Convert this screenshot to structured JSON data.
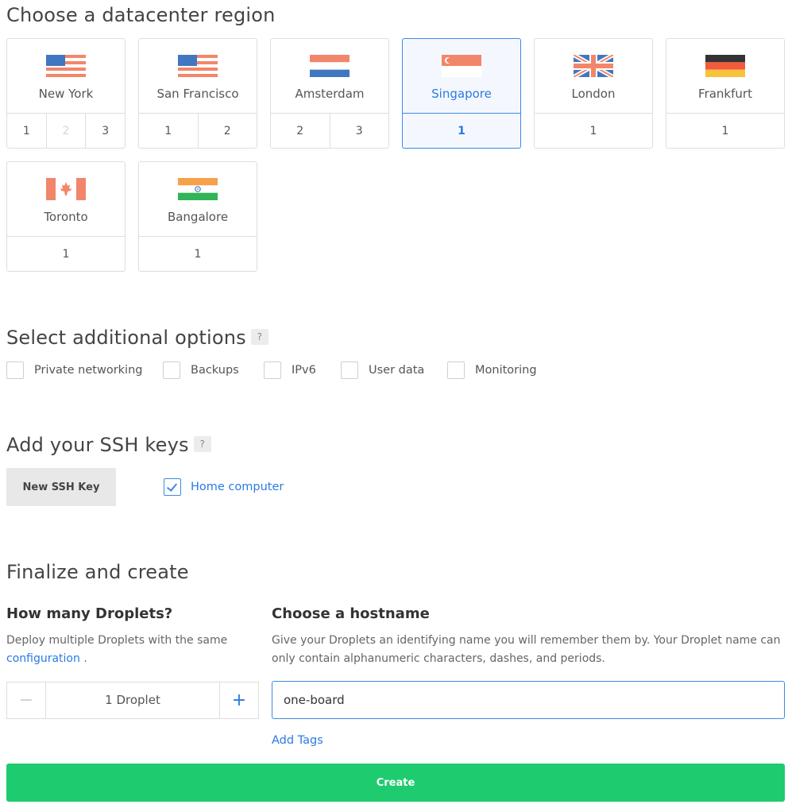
{
  "regions_section": {
    "title": "Choose a datacenter region",
    "regions": [
      {
        "name": "New York",
        "flag": "us-flag-icon",
        "nums": [
          "1",
          "2",
          "3"
        ]
      },
      {
        "name": "San Francisco",
        "flag": "us-flag-icon",
        "nums": [
          "1",
          "2"
        ]
      },
      {
        "name": "Amsterdam",
        "flag": "nl-flag-icon",
        "nums": [
          "2",
          "3"
        ]
      },
      {
        "name": "Singapore",
        "flag": "sg-flag-icon",
        "nums": [
          "1"
        ],
        "selected": true
      },
      {
        "name": "London",
        "flag": "uk-flag-icon",
        "nums": [
          "1"
        ]
      },
      {
        "name": "Frankfurt",
        "flag": "de-flag-icon",
        "nums": [
          "1"
        ]
      },
      {
        "name": "Toronto",
        "flag": "ca-flag-icon",
        "nums": [
          "1"
        ]
      },
      {
        "name": "Bangalore",
        "flag": "in-flag-icon",
        "nums": [
          "1"
        ]
      }
    ]
  },
  "options_section": {
    "title": "Select additional options",
    "help": "?",
    "options": [
      "Private networking",
      "Backups",
      "IPv6",
      "User data",
      "Monitoring"
    ]
  },
  "ssh_section": {
    "title": "Add your SSH keys",
    "help": "?",
    "new_key_label": "New SSH Key",
    "key_label": "Home computer",
    "key_checked": true
  },
  "finalize_section": {
    "title": "Finalize and create",
    "droplets_heading": "How many Droplets?",
    "droplets_desc": "Deploy multiple Droplets with the same",
    "droplets_link": "configuration",
    "droplets_desc_end": ".",
    "stepper_minus": "−",
    "stepper_plus": "+",
    "droplet_count": "1",
    "droplet_unit": "Droplet",
    "hostname_heading": "Choose a hostname",
    "hostname_desc": "Give your Droplets an identifying name you will remember them by. Your Droplet name can only contain alphanumeric characters, dashes, and periods.",
    "hostname_value": "one-board",
    "add_tags": "Add Tags",
    "create_label": "Create"
  },
  "colors": {
    "accent": "#2a7ae2",
    "selected_border": "#3b8be6",
    "create_green": "#1ecb6f"
  }
}
